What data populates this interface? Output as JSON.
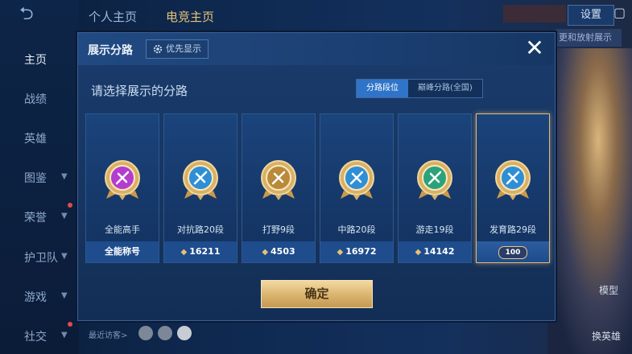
{
  "background": {
    "top_tabs": [
      {
        "label": "个人主页",
        "active": false
      },
      {
        "label": "电竞主页",
        "active": true
      }
    ],
    "sidebar": [
      {
        "label": "主页",
        "active": true,
        "arrow": false,
        "dot": false
      },
      {
        "label": "战绩",
        "active": false,
        "arrow": false,
        "dot": false
      },
      {
        "label": "英雄",
        "active": false,
        "arrow": false,
        "dot": false
      },
      {
        "label": "图鉴",
        "active": false,
        "arrow": true,
        "dot": false
      },
      {
        "label": "荣誉",
        "active": false,
        "arrow": true,
        "dot": true
      },
      {
        "label": "护卫队",
        "active": false,
        "arrow": true,
        "dot": false
      },
      {
        "label": "游戏",
        "active": false,
        "arrow": true,
        "dot": false
      },
      {
        "label": "社交",
        "active": false,
        "arrow": true,
        "dot": true
      }
    ],
    "settings_label": "设置",
    "strip_text": "更和放射展示",
    "mode_label": "模型",
    "swap_label": "换英雄",
    "visitors_label": "最近访客>"
  },
  "modal": {
    "title": "展示分路",
    "priority_label": "优先显示",
    "close_label": "✕",
    "subtitle": "请选择展示的分路",
    "segments": [
      {
        "label": "分路段位",
        "active": true
      },
      {
        "label": "巅峰分路(全国)",
        "active": false
      }
    ],
    "cards": [
      {
        "name": "全能高手",
        "bar": "全能称号",
        "diamond": false,
        "selected": false,
        "color": "#b43ccf",
        "icon": "versatile-icon"
      },
      {
        "name": "对抗路20段",
        "bar": "16211",
        "diamond": true,
        "selected": false,
        "color": "#2e8fd6",
        "icon": "clash-lane-icon"
      },
      {
        "name": "打野9段",
        "bar": "4503",
        "diamond": true,
        "selected": false,
        "color": "#b98a3a",
        "icon": "jungle-icon"
      },
      {
        "name": "中路20段",
        "bar": "16972",
        "diamond": true,
        "selected": false,
        "color": "#2e8fd6",
        "icon": "mid-lane-icon"
      },
      {
        "name": "游走19段",
        "bar": "14142",
        "diamond": true,
        "selected": false,
        "color": "#2aa37c",
        "icon": "roam-icon"
      },
      {
        "name": "发育路29段",
        "bar": "100",
        "diamond": false,
        "selected": true,
        "color": "#2e8fd6",
        "icon": "farm-lane-icon"
      }
    ],
    "confirm_label": "确定"
  }
}
